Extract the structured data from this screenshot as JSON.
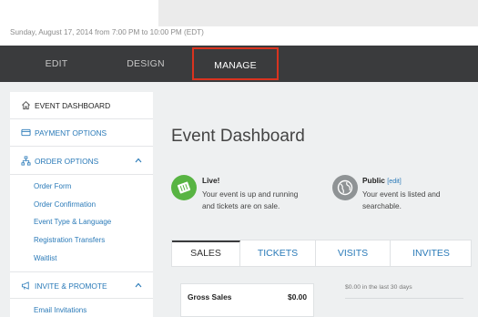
{
  "header": {
    "event_date": "Sunday, August 17, 2014 from 7:00 PM to 10:00 PM (EDT)"
  },
  "nav": {
    "tabs": [
      {
        "label": "EDIT"
      },
      {
        "label": "DESIGN"
      },
      {
        "label": "MANAGE",
        "active": true
      }
    ],
    "highlight_color": "#d9331f"
  },
  "sidebar": {
    "dashboard": {
      "label": "EVENT DASHBOARD",
      "icon": "home-icon"
    },
    "payment": {
      "label": "PAYMENT OPTIONS",
      "icon": "credit-card-icon"
    },
    "order": {
      "label": "ORDER OPTIONS",
      "icon": "sitemap-icon",
      "items": [
        {
          "label": "Order Form"
        },
        {
          "label": "Order Confirmation"
        },
        {
          "label": "Event Type & Language"
        },
        {
          "label": "Registration Transfers"
        },
        {
          "label": "Waitlist"
        }
      ]
    },
    "invite": {
      "label": "INVITE & PROMOTE",
      "icon": "megaphone-icon",
      "items": [
        {
          "label": "Email Invitations"
        }
      ]
    }
  },
  "main": {
    "title": "Event Dashboard",
    "live": {
      "title": "Live!",
      "line1": "Your event is up and running",
      "line2": "and tickets are on sale.",
      "color": "#58b443"
    },
    "public": {
      "title": "Public",
      "edit_label": "[edit]",
      "line1": "Your event is listed and",
      "line2": "searchable."
    },
    "tabs": [
      {
        "label": "SALES",
        "active": true
      },
      {
        "label": "TICKETS"
      },
      {
        "label": "VISITS"
      },
      {
        "label": "INVITES"
      }
    ],
    "sales": {
      "gross_label": "Gross Sales",
      "gross_value": "$0.00",
      "period_text": "$0.00 in the last 30 days"
    }
  },
  "colors": {
    "link": "#2a7ab8",
    "navbar": "#3a3b3d",
    "background": "#eef0f1"
  }
}
